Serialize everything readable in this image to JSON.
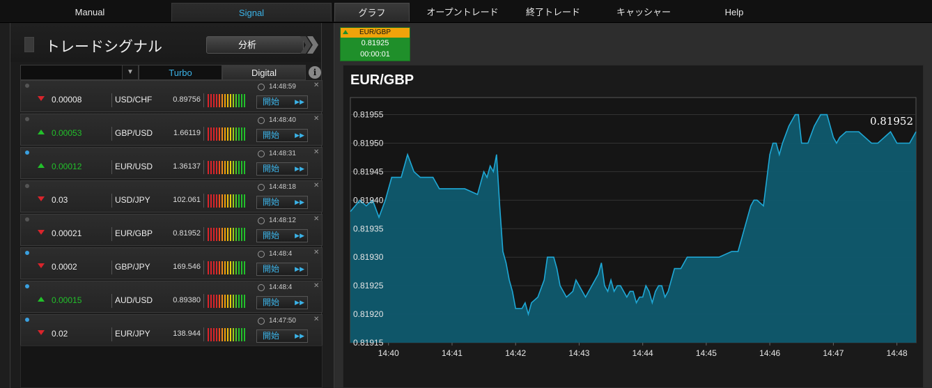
{
  "nav": {
    "manual": "Manual",
    "signal": "Signal",
    "graph": "グラフ",
    "open_trades": "オープントレード",
    "closed_trades": "終了トレード",
    "cashier": "キャッシャー",
    "help": "Help"
  },
  "left": {
    "title": "トレードシグナル",
    "analyze": "分析",
    "filter": {
      "turbo": "Turbo",
      "digital": "Digital",
      "info": "i"
    }
  },
  "start_label": "開始",
  "signals": [
    {
      "dot": "dark",
      "dir": "down",
      "change": "0.00008",
      "pair": "USD/CHF",
      "price": "0.89756",
      "time": "14:48:59"
    },
    {
      "dot": "dark",
      "dir": "up",
      "change": "0.00053",
      "pair": "GBP/USD",
      "price": "1.66119",
      "time": "14:48:40"
    },
    {
      "dot": "blue",
      "dir": "up",
      "change": "0.00012",
      "pair": "EUR/USD",
      "price": "1.36137",
      "time": "14:48:31"
    },
    {
      "dot": "dark",
      "dir": "down",
      "change": "0.03",
      "pair": "USD/JPY",
      "price": "102.061",
      "time": "14:48:18"
    },
    {
      "dot": "dark",
      "dir": "down",
      "change": "0.00021",
      "pair": "EUR/GBP",
      "price": "0.81952",
      "time": "14:48:12"
    },
    {
      "dot": "blue",
      "dir": "down",
      "change": "0.0002",
      "pair": "GBP/JPY",
      "price": "169.546",
      "time": "14:48:4"
    },
    {
      "dot": "blue",
      "dir": "up",
      "change": "0.00015",
      "pair": "AUD/USD",
      "price": "0.89380",
      "time": "14:48:4"
    },
    {
      "dot": "blue",
      "dir": "down",
      "change": "0.02",
      "pair": "EUR/JPY",
      "price": "138.944",
      "time": "14:47:50"
    }
  ],
  "ticker": {
    "pair": "EUR/GBP",
    "price": "0.81925",
    "countdown": "00:00:01"
  },
  "colors": {
    "accent": "#3bb3e8",
    "up": "#22c02a",
    "down": "#d9242b",
    "line": "#1fa8d6",
    "fill": "#0f5a6e",
    "ticker_head": "#f0a30a",
    "ticker_bg": "#1f8f2a"
  },
  "chart_data": {
    "type": "area",
    "title": "EUR/GBP",
    "last_value_label": "0.81952",
    "ylim": [
      0.81915,
      0.81958
    ],
    "yticks": [
      0.81915,
      0.8192,
      0.81925,
      0.8193,
      0.81935,
      0.8194,
      0.81945,
      0.8195,
      0.81955
    ],
    "ytick_labels": [
      "0.81915",
      "0.81920",
      "0.81925",
      "0.81930",
      "0.81935",
      "0.81940",
      "0.81945",
      "0.81950",
      "0.81955"
    ],
    "xlim": [
      -0.6,
      8.3
    ],
    "xticks": [
      0,
      1,
      2,
      3,
      4,
      5,
      6,
      7,
      8
    ],
    "xtick_labels": [
      "14:40",
      "14:41",
      "14:42",
      "14:43",
      "14:44",
      "14:45",
      "14:46",
      "14:47",
      "14:48"
    ],
    "grid": true,
    "x": [
      -0.6,
      -0.45,
      -0.35,
      -0.25,
      -0.15,
      -0.05,
      0.05,
      0.2,
      0.3,
      0.4,
      0.5,
      0.6,
      0.7,
      0.8,
      1,
      1.2,
      1.4,
      1.5,
      1.55,
      1.6,
      1.65,
      1.7,
      1.75,
      1.8,
      1.85,
      1.9,
      1.95,
      2,
      2.1,
      2.15,
      2.2,
      2.25,
      2.35,
      2.45,
      2.5,
      2.55,
      2.6,
      2.65,
      2.7,
      2.8,
      2.9,
      2.95,
      3,
      3.1,
      3.2,
      3.3,
      3.35,
      3.4,
      3.45,
      3.5,
      3.55,
      3.6,
      3.65,
      3.7,
      3.75,
      3.8,
      3.85,
      3.9,
      3.95,
      4,
      4.05,
      4.1,
      4.15,
      4.2,
      4.25,
      4.3,
      4.35,
      4.4,
      4.5,
      4.6,
      4.7,
      4.8,
      5,
      5.2,
      5.4,
      5.5,
      5.6,
      5.7,
      5.75,
      5.8,
      5.9,
      6,
      6.05,
      6.1,
      6.15,
      6.2,
      6.3,
      6.4,
      6.45,
      6.5,
      6.6,
      6.7,
      6.8,
      6.9,
      7,
      7.05,
      7.1,
      7.2,
      7.3,
      7.4,
      7.5,
      7.6,
      7.7,
      7.8,
      7.9,
      8,
      8.1,
      8.2,
      8.3
    ],
    "y": [
      0.81938,
      0.8194,
      0.81939,
      0.8194,
      0.81937,
      0.8194,
      0.81944,
      0.81944,
      0.81948,
      0.81945,
      0.81944,
      0.81944,
      0.81944,
      0.81942,
      0.81942,
      0.81942,
      0.81941,
      0.81945,
      0.81944,
      0.81946,
      0.81945,
      0.81948,
      0.81939,
      0.81931,
      0.81929,
      0.81926,
      0.81924,
      0.81921,
      0.81921,
      0.81922,
      0.8192,
      0.81922,
      0.81923,
      0.81926,
      0.8193,
      0.8193,
      0.8193,
      0.81928,
      0.81925,
      0.81923,
      0.81924,
      0.81926,
      0.81925,
      0.81923,
      0.81925,
      0.81927,
      0.81929,
      0.81925,
      0.81924,
      0.81926,
      0.81924,
      0.81925,
      0.81925,
      0.81924,
      0.81923,
      0.81924,
      0.81924,
      0.81922,
      0.81923,
      0.81923,
      0.81925,
      0.81924,
      0.81922,
      0.81924,
      0.81925,
      0.81925,
      0.81923,
      0.81924,
      0.81928,
      0.81928,
      0.8193,
      0.8193,
      0.8193,
      0.8193,
      0.81931,
      0.81931,
      0.81935,
      0.81939,
      0.8194,
      0.8194,
      0.81939,
      0.81948,
      0.8195,
      0.8195,
      0.81948,
      0.8195,
      0.81953,
      0.81955,
      0.81955,
      0.8195,
      0.8195,
      0.81953,
      0.81955,
      0.81955,
      0.81951,
      0.8195,
      0.81951,
      0.81952,
      0.81952,
      0.81952,
      0.81951,
      0.8195,
      0.8195,
      0.81951,
      0.81952,
      0.8195,
      0.8195,
      0.8195,
      0.81952
    ]
  }
}
